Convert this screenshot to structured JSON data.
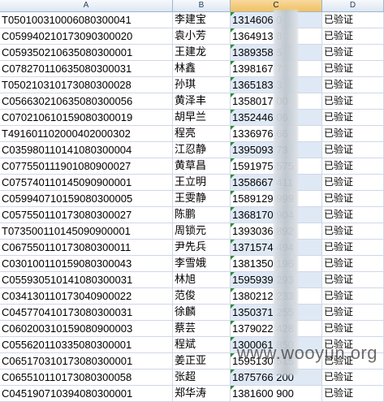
{
  "columns": [
    "A",
    "B",
    "C",
    "D"
  ],
  "rows": [
    {
      "id": "T050100310006080300041",
      "name": "李建宝",
      "phone": "1314606   0",
      "status": "已验证"
    },
    {
      "id": "C059940210173090300020",
      "name": "袁小芳",
      "phone": "1364913   8",
      "status": "已验证"
    },
    {
      "id": "C059350210635080300001",
      "name": "王建龙",
      "phone": "1389358   5",
      "status": "已验证"
    },
    {
      "id": "C078270110635080300031",
      "name": "林鑫",
      "phone": "1398167   7",
      "status": "已验证"
    },
    {
      "id": "T050210310173080300028",
      "name": "孙琪",
      "phone": "1365183   3",
      "status": "已验证"
    },
    {
      "id": "C056630210635080300056",
      "name": "黄泽丰",
      "phone": "1358017   00",
      "status": "已验证"
    },
    {
      "id": "C070210610159080300019",
      "name": "胡早兰",
      "phone": "1352446   06",
      "status": "已验证"
    },
    {
      "id": "T491601102000402000302",
      "name": "程亮",
      "phone": "1336976   66",
      "status": "已验证"
    },
    {
      "id": "C035980110141080300004",
      "name": "江忍静",
      "phone": "1395093   73",
      "status": "已验证"
    },
    {
      "id": "C077550111901080900027",
      "name": "黄草昌",
      "phone": "1591975   575",
      "status": "已验证"
    },
    {
      "id": "C075740110145090900001",
      "name": "王立明",
      "phone": "1358667   411",
      "status": "已验证"
    },
    {
      "id": "C059940710159080300005",
      "name": "王雯静",
      "phone": "1589129   999",
      "status": "已验证"
    },
    {
      "id": "C057550110173080300027",
      "name": "陈鹏",
      "phone": "1368170   904",
      "status": "已验证"
    },
    {
      "id": "T073500110145090900001",
      "name": "周锁元",
      "phone": "1393036   892",
      "status": "已验证"
    },
    {
      "id": "C067550110173080300011",
      "name": "尹先兵",
      "phone": "1371574   494",
      "status": "已验证"
    },
    {
      "id": "C030100110159080300043",
      "name": "李雪娥",
      "phone": "1381350   196",
      "status": "已验证"
    },
    {
      "id": "C055930510141080300031",
      "name": "林旭",
      "phone": "1595939   293",
      "status": "已验证"
    },
    {
      "id": "C034130110173040900022",
      "name": "范俊",
      "phone": "1380212   233",
      "status": "已验证"
    },
    {
      "id": "C045770410173080300031",
      "name": "徐麟",
      "phone": "1350371   255",
      "status": "已验证"
    },
    {
      "id": "C060200310159080900003",
      "name": "蔡芸",
      "phone": "1379022   428",
      "status": "已验证"
    },
    {
      "id": "C055620110335080300001",
      "name": "程斌",
      "phone": "1300061   850",
      "status": "已验证"
    },
    {
      "id": "C065170310173080300001",
      "name": "姜正亚",
      "phone": "1595130   515",
      "status": "已验证"
    },
    {
      "id": "C065510110173080300058",
      "name": "张超",
      "phone": "1875766   200",
      "status": "已验证"
    },
    {
      "id": "C045190710394080300001",
      "name": "郑华涛",
      "phone": "1381600   900",
      "status": "已验证"
    }
  ],
  "watermark": "www.wooyun.org"
}
